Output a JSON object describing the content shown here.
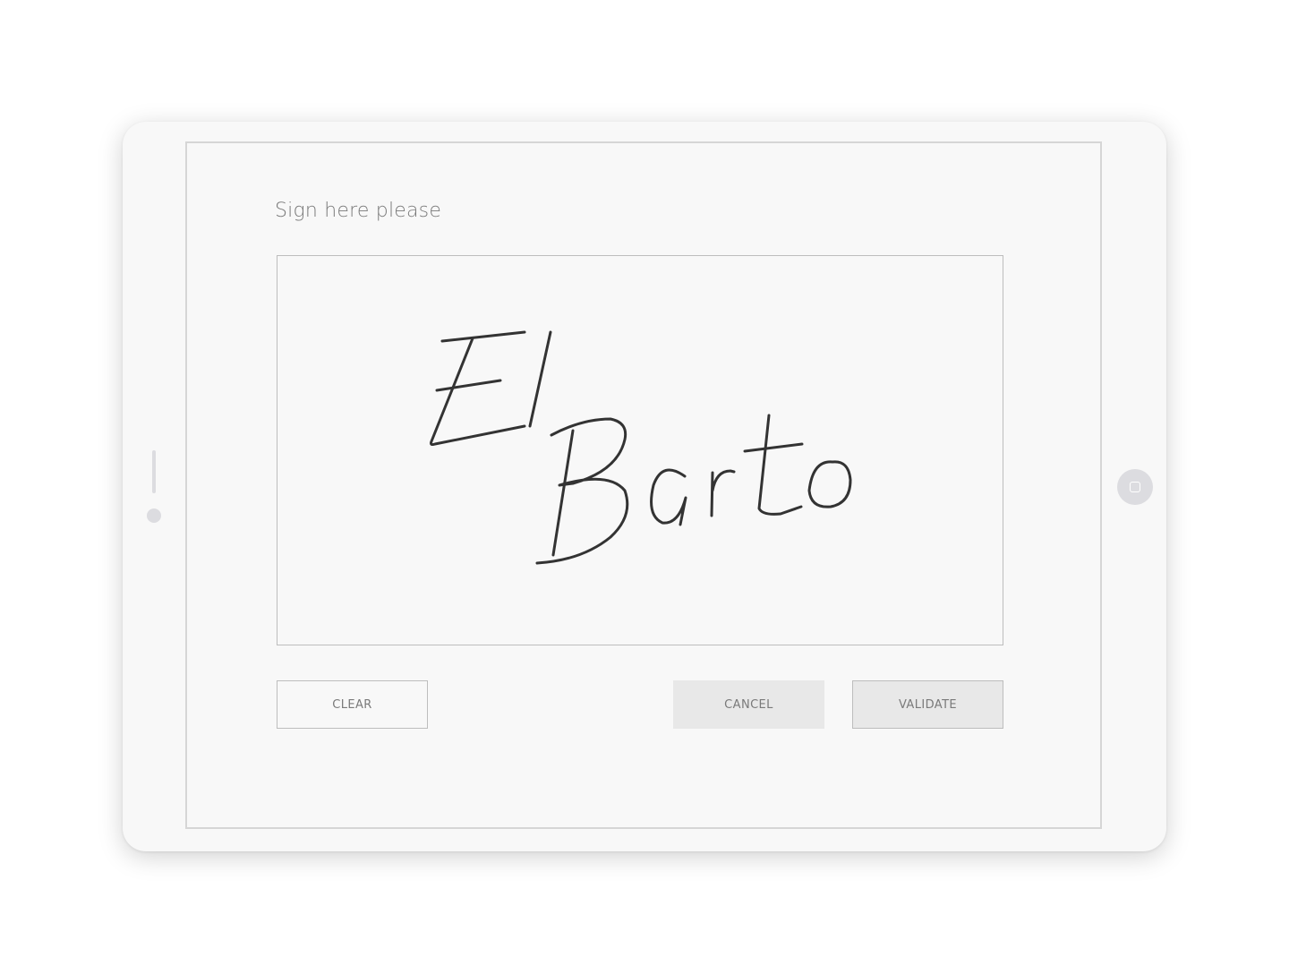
{
  "dialog": {
    "prompt": "Sign here please"
  },
  "signature": {
    "handwritten_text": "El Barto",
    "stroke_color": "#333333"
  },
  "buttons": {
    "clear_label": "CLEAR",
    "cancel_label": "CANCEL",
    "validate_label": "VALIDATE"
  },
  "colors": {
    "device_body": "#f8f8f8",
    "screen_border": "#d6d6d6",
    "button_fill": "#e8e8e8",
    "text": "#7a7a7a"
  },
  "icons": {
    "home_button": "home-button-icon"
  }
}
